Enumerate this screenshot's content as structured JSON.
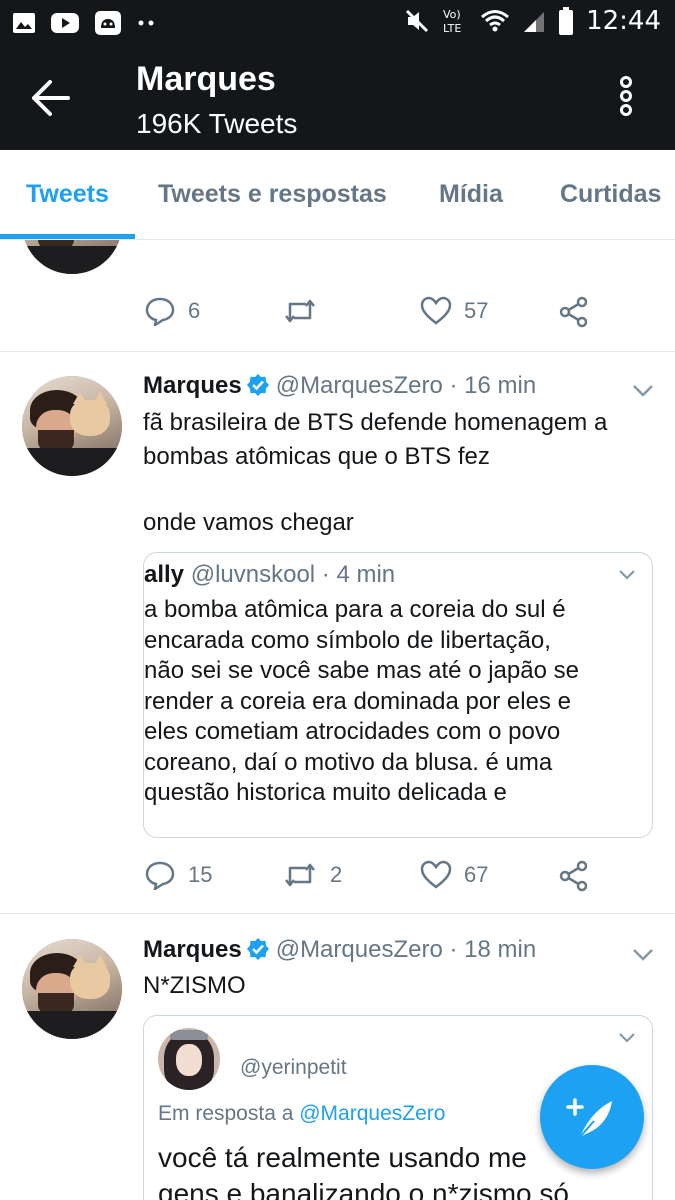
{
  "status_bar": {
    "time": "12:44",
    "network": "LTE",
    "icons": [
      "gallery-icon",
      "youtube-icon",
      "android-icon",
      "dots-icon",
      "mute-icon",
      "volte-icon",
      "wifi-icon",
      "signal-icon",
      "battery-icon"
    ]
  },
  "header": {
    "title": "Marques",
    "subtitle": "196K Tweets"
  },
  "tabs": [
    {
      "label": "Tweets",
      "active": true
    },
    {
      "label": "Tweets e respostas",
      "active": false
    },
    {
      "label": "Mídia",
      "active": false
    },
    {
      "label": "Curtidas",
      "active": false
    }
  ],
  "tweets": [
    {
      "replies": "6",
      "retweets": "",
      "likes": "57"
    },
    {
      "name": "Marques",
      "handle": "@MarquesZero",
      "time": "· 16 min",
      "text_line1": "fã brasileira de BTS defende homenagem a",
      "text_line2": "bombas atômicas que o BTS fez",
      "text_line3": "onde vamos chegar",
      "quote": {
        "name": "ally",
        "handle": "@luvnskool",
        "time": "· 4 min",
        "lines": [
          "a bomba atômica para a coreia do sul é",
          "encarada como símbolo de libertação,",
          "não sei se você sabe mas até o japão se",
          "render a coreia era dominada por eles e",
          "eles cometiam atrocidades com o povo",
          "coreano, daí o motivo da blusa. é uma",
          "questão historica muito delicada e"
        ]
      },
      "replies": "15",
      "retweets": "2",
      "likes": "67"
    },
    {
      "name": "Marques",
      "handle": "@MarquesZero",
      "time": "· 18 min",
      "text_line1": "N*ZISMO",
      "quote": {
        "handle": "@yerinpetit",
        "reply_prefix": "Em resposta a ",
        "reply_to": "@MarquesZero",
        "line1": "você tá realmente usando me",
        "line2": "gens e banalizando o n*zismo só"
      }
    }
  ],
  "colors": {
    "bar": "#14171a",
    "accent": "#1da1f2",
    "secondary_text": "#657786",
    "divider": "#e1e8ed"
  }
}
